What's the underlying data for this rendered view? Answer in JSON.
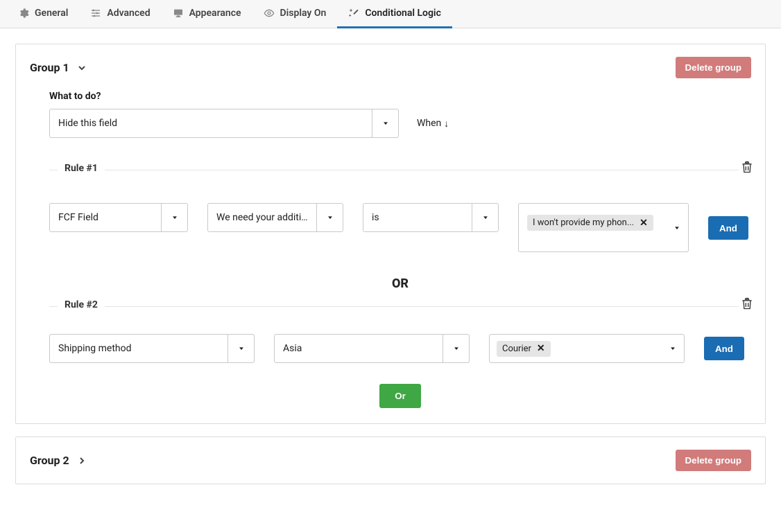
{
  "tabs": {
    "general": "General",
    "advanced": "Advanced",
    "appearance": "Appearance",
    "display_on": "Display On",
    "conditional_logic": "Conditional Logic"
  },
  "group1": {
    "title": "Group 1",
    "delete_label": "Delete group",
    "wtd_label": "What to do?",
    "wtd_value": "Hide this field",
    "when_label": "When",
    "rule1": {
      "title": "Rule #1",
      "src_type": "FCF Field",
      "field": "We need your addition...",
      "op": "is",
      "value_tag": "I won't provide my phon...",
      "and_label": "And"
    },
    "or_sep": "OR",
    "rule2": {
      "title": "Rule #2",
      "src_type": "Shipping method",
      "field": "Asia",
      "value_tag": "Courier",
      "and_label": "And"
    },
    "or_btn": "Or"
  },
  "group2": {
    "title": "Group 2",
    "delete_label": "Delete group"
  }
}
